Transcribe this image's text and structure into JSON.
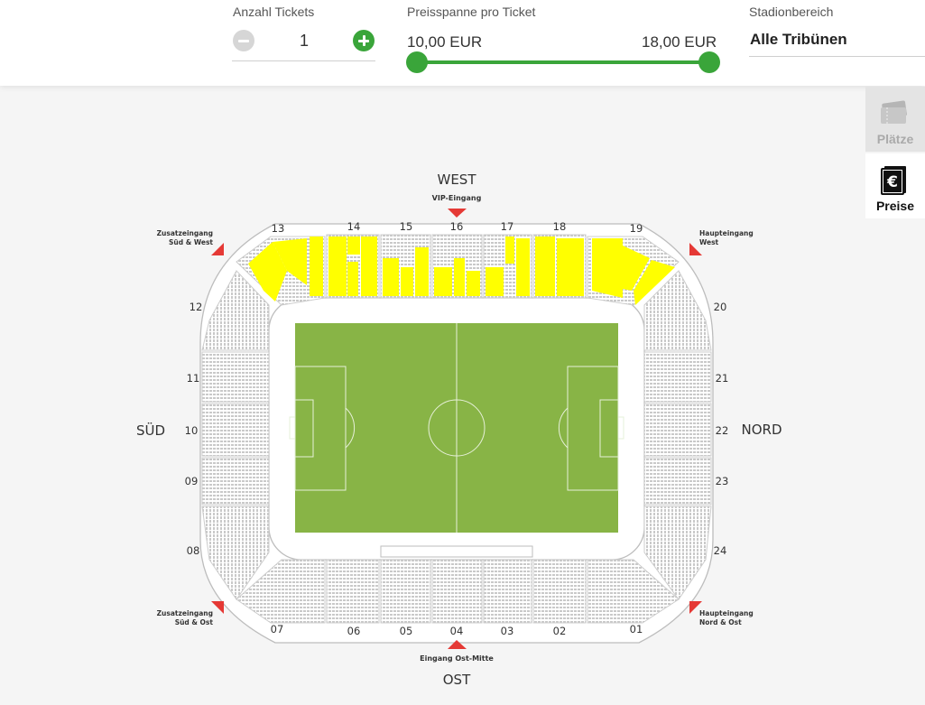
{
  "filters": {
    "tickets": {
      "label": "Anzahl Tickets",
      "value": "1"
    },
    "price": {
      "label": "Preisspanne pro Ticket",
      "min_label": "10,00 EUR",
      "max_label": "18,00 EUR"
    },
    "area": {
      "label": "Stadionbereich",
      "value": "Alle Tribünen"
    }
  },
  "side_tabs": [
    {
      "label": "Plätze",
      "icon": "tickets-icon"
    },
    {
      "label": "Preise",
      "icon": "euro-icon"
    }
  ],
  "stadium": {
    "directions": {
      "west": "WEST",
      "ost": "OST",
      "sued": "SÜD",
      "nord": "NORD"
    },
    "entrances": {
      "vip": "VIP-Eingang",
      "ost_mitte": "Eingang Ost-Mitte",
      "sw_line1": "Zusatzeingang",
      "sw_line2": "Süd & West",
      "so_line1": "Zusatzeingang",
      "so_line2": "Süd & Ost",
      "hw_line1": "Haupteingang",
      "hw_line2": "West",
      "no_line1": "Haupteingang",
      "no_line2": "Nord & Ost"
    },
    "blocks_top": [
      "13",
      "14",
      "15",
      "16",
      "17",
      "18",
      "19"
    ],
    "blocks_bottom": [
      "07",
      "06",
      "05",
      "04",
      "03",
      "02",
      "01"
    ],
    "blocks_left": [
      "12",
      "11",
      "10",
      "09",
      "08"
    ],
    "blocks_right": [
      "20",
      "21",
      "22",
      "23",
      "24"
    ],
    "colors": {
      "available": "#ffff00",
      "pitch": "#88b446",
      "accent": "#3aa53a",
      "entrance_marker": "#e53935"
    }
  }
}
